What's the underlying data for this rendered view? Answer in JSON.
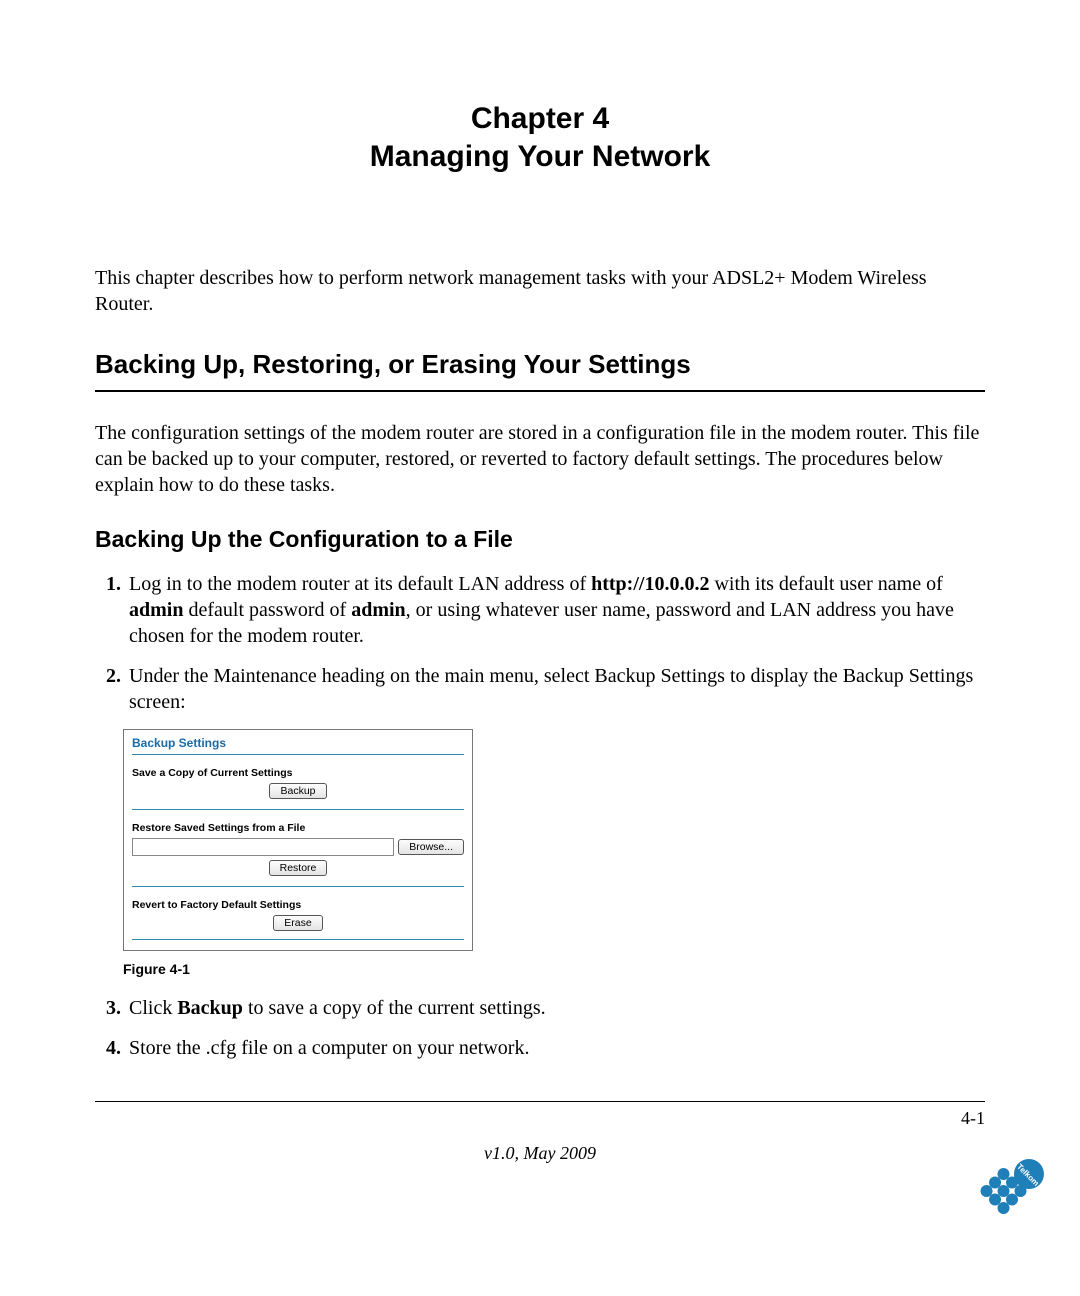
{
  "chapter": {
    "line1": "Chapter 4",
    "line2": "Managing Your Network"
  },
  "intro": "This chapter describes how to perform network management tasks with your ADSL2+ Modem Wireless Router.",
  "section1": {
    "heading": "Backing Up, Restoring, or Erasing Your Settings",
    "para": "The configuration settings of the modem router are stored in a configuration file in the modem router. This file can be backed up to your computer, restored, or reverted to factory default settings. The procedures below explain how to do these tasks."
  },
  "section2": {
    "heading": "Backing Up the Configuration to a File",
    "step1_pre": "Log in to the modem router at its default LAN address of ",
    "step1_url": "http://10.0.0.2",
    "step1_mid1": " with its default user name of ",
    "step1_admin1": "admin",
    "step1_mid2": " default password of ",
    "step1_admin2": "admin",
    "step1_post": ", or using whatever user name, password and LAN address you have chosen for the modem router.",
    "step2": "Under the Maintenance heading on the main menu, select Backup Settings to display the Backup Settings screen:",
    "step3_pre": "Click ",
    "step3_bold": "Backup",
    "step3_post": " to save a copy of the current settings.",
    "step4": "Store the .cfg file on a computer on your network."
  },
  "screenshot": {
    "title": "Backup Settings",
    "save_label": "Save a Copy of Current Settings",
    "backup_btn": "Backup",
    "restore_label": "Restore Saved Settings from a File",
    "browse_btn": "Browse...",
    "restore_btn": "Restore",
    "revert_label": "Revert to Factory Default Settings",
    "erase_btn": "Erase"
  },
  "figure_caption": "Figure 4-1",
  "footer": {
    "page": "4-1",
    "version": "v1.0, May 2009"
  },
  "logo_text": "Telkom"
}
